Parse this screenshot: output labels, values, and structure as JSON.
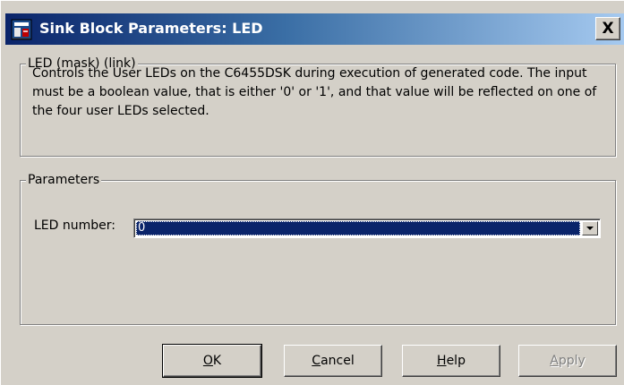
{
  "window": {
    "title": "Sink Block Parameters: LED",
    "close_label": "X"
  },
  "description_group": {
    "label": "LED (mask) (link)",
    "text": "Controls the User LEDs on the C6455DSK during execution of generated code.  The input must be a boolean value, that is either '0' or '1', and that value will be reflected on one of the four user LEDs selected."
  },
  "parameters_group": {
    "label": "Parameters",
    "led_number": {
      "label": "LED number:",
      "value": "0"
    }
  },
  "buttons": {
    "ok": {
      "label_accel": "O",
      "label_rest": "K"
    },
    "cancel": {
      "label_accel": "C",
      "label_rest": "ancel"
    },
    "help": {
      "label_accel": "H",
      "label_rest": "elp"
    },
    "apply": {
      "label_accel": "A",
      "label_rest": "pply",
      "enabled": false
    }
  },
  "colors": {
    "titlebar_start": "#0a246a",
    "titlebar_end": "#a6caf0",
    "dialog_bg": "#d4d0c8",
    "selection_bg": "#0a246a"
  },
  "icons": [
    "simulink-block-icon",
    "chevron-down-icon"
  ]
}
